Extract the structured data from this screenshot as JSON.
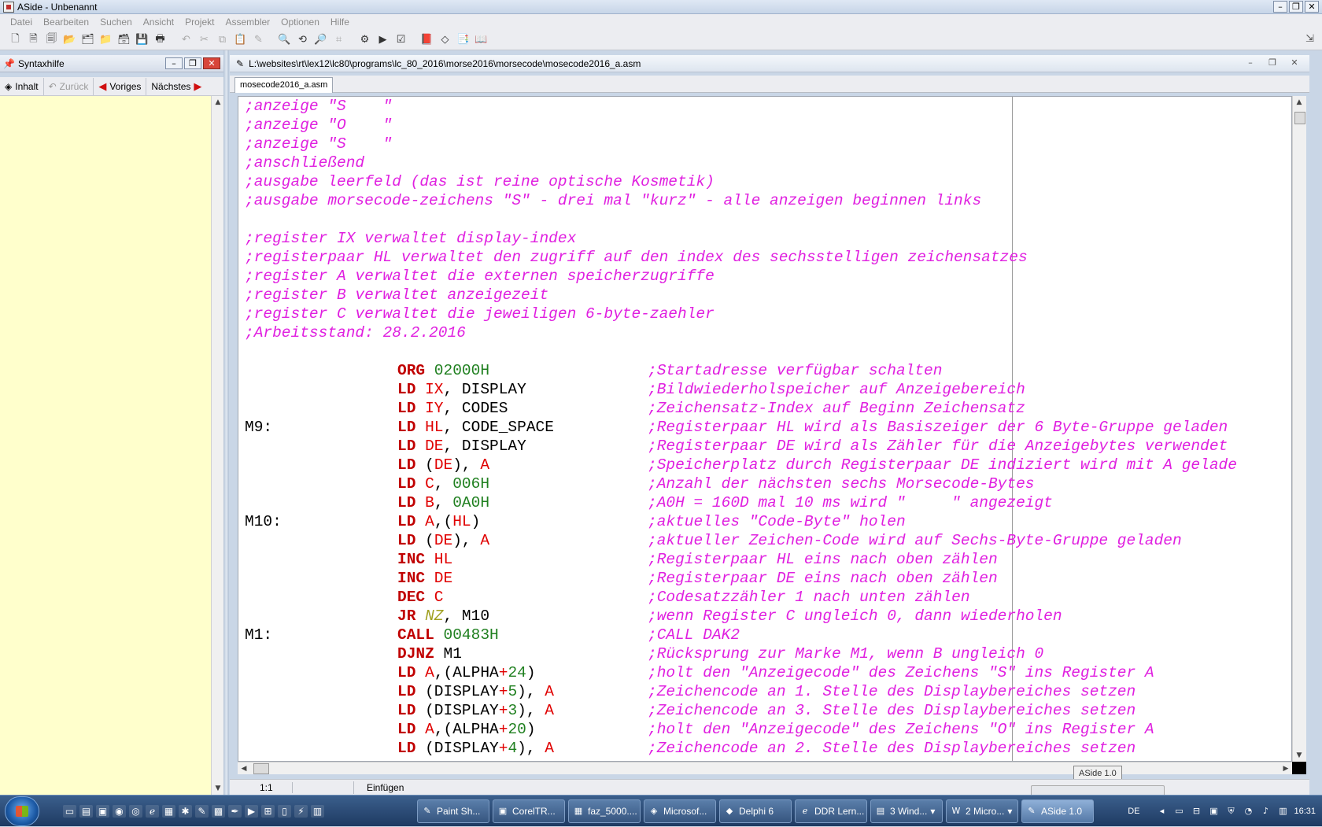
{
  "window": {
    "title": "ASide - Unbenannt"
  },
  "menu": [
    "Datei",
    "Bearbeiten",
    "Suchen",
    "Ansicht",
    "Projekt",
    "Assembler",
    "Optionen",
    "Hilfe"
  ],
  "left_panel": {
    "title": "Syntaxhilfe",
    "nav": {
      "contents": "Inhalt",
      "back": "Zurück",
      "previous": "Voriges",
      "next": "Nächstes"
    }
  },
  "editor": {
    "path": "L:\\websites\\rt\\lex12\\lc80\\programs\\lc_80_2016\\morse2016\\morsecode\\mosecode2016_a.asm",
    "tab": "mosecode2016_a.asm",
    "header_comments": [
      ";anzeige \"S    \"",
      ";anzeige \"O    \"",
      ";anzeige \"S    \"",
      ";anschließend",
      ";ausgabe leerfeld (das ist reine optische Kosmetik)",
      ";ausgabe morsecode-zeichens \"S\" - drei mal \"kurz\" - alle anzeigen beginnen links",
      "",
      ";register IX verwaltet display-index",
      ";registerpaar HL verwaltet den zugriff auf den index des sechsstelligen zeichensatzes",
      ";register A verwaltet die externen speicherzugriffe",
      ";register B verwaltet anzeigezeit",
      ";register C verwaltet die jeweiligen 6-byte-zaehler",
      ";Arbeitsstand: 28.2.2016",
      ""
    ],
    "code_lines": [
      {
        "label": "",
        "op": "ORG",
        "args": [
          [
            "nm",
            " 02000H"
          ]
        ],
        "comment": ";Startadresse verfügbar schalten"
      },
      {
        "label": "",
        "op": "LD",
        "args": [
          [
            "rg",
            " IX"
          ],
          [
            "pl",
            ", DISPLAY"
          ]
        ],
        "comment": ";Bildwiederholspeicher auf Anzeigebereich"
      },
      {
        "label": "",
        "op": "LD",
        "args": [
          [
            "rg",
            " IY"
          ],
          [
            "pl",
            ", CODES"
          ]
        ],
        "comment": ";Zeichensatz-Index auf Beginn Zeichensatz"
      },
      {
        "label": "M9:",
        "op": "LD",
        "args": [
          [
            "rg",
            " HL"
          ],
          [
            "pl",
            ", CODE_SPACE"
          ]
        ],
        "comment": ";Registerpaar HL wird als Basiszeiger der 6 Byte-Gruppe geladen"
      },
      {
        "label": "",
        "op": "LD",
        "args": [
          [
            "rg",
            " DE"
          ],
          [
            "pl",
            ", DISPLAY"
          ]
        ],
        "comment": ";Registerpaar DE wird als Zähler für die Anzeigebytes verwendet"
      },
      {
        "label": "",
        "op": "LD",
        "args": [
          [
            "pl",
            " ("
          ],
          [
            "rg",
            "DE"
          ],
          [
            "pl",
            "), "
          ],
          [
            "rg",
            "A"
          ]
        ],
        "comment": ";Speicherplatz durch Registerpaar DE indiziert wird mit A gelade"
      },
      {
        "label": "",
        "op": "LD",
        "args": [
          [
            "rg",
            " C"
          ],
          [
            "pl",
            ", "
          ],
          [
            "nm",
            "006H"
          ]
        ],
        "comment": ";Anzahl der nächsten sechs Morsecode-Bytes"
      },
      {
        "label": "",
        "op": "LD",
        "args": [
          [
            "rg",
            " B"
          ],
          [
            "pl",
            ", "
          ],
          [
            "nm",
            "0A0H"
          ]
        ],
        "comment": ";A0H = 160D mal 10 ms wird \"     \" angezeigt"
      },
      {
        "label": "M10:",
        "op": "LD",
        "args": [
          [
            "rg",
            " A"
          ],
          [
            "pl",
            ",("
          ],
          [
            "rg",
            "HL"
          ],
          [
            "pl",
            ")"
          ]
        ],
        "comment": ";aktuelles \"Code-Byte\" holen"
      },
      {
        "label": "",
        "op": "LD",
        "args": [
          [
            "pl",
            " ("
          ],
          [
            "rg",
            "DE"
          ],
          [
            "pl",
            "), "
          ],
          [
            "rg",
            "A"
          ]
        ],
        "comment": ";aktueller Zeichen-Code wird auf Sechs-Byte-Gruppe geladen"
      },
      {
        "label": "",
        "op": "INC",
        "args": [
          [
            "rg",
            " HL"
          ]
        ],
        "comment": ";Registerpaar HL eins nach oben zählen"
      },
      {
        "label": "",
        "op": "INC",
        "args": [
          [
            "rg",
            " DE"
          ]
        ],
        "comment": ";Registerpaar DE eins nach oben zählen"
      },
      {
        "label": "",
        "op": "DEC",
        "args": [
          [
            "rg",
            " C"
          ]
        ],
        "comment": ";Codesatzzähler 1 nach unten zählen"
      },
      {
        "label": "",
        "op": "JR",
        "args": [
          [
            "cc",
            " NZ"
          ],
          [
            "pl",
            ", M10"
          ]
        ],
        "comment": ";wenn Register C ungleich 0, dann wiederholen"
      },
      {
        "label": "M1:",
        "op": "CALL",
        "args": [
          [
            "nm",
            " 00483H"
          ]
        ],
        "comment": ";CALL DAK2"
      },
      {
        "label": "",
        "op": "DJNZ",
        "args": [
          [
            "pl",
            " M1"
          ]
        ],
        "comment": ";Rücksprung zur Marke M1, wenn B ungleich 0"
      },
      {
        "label": "",
        "op": "LD",
        "args": [
          [
            "rg",
            " A"
          ],
          [
            "pl",
            ",(ALPHA"
          ],
          [
            "rg",
            "+"
          ],
          [
            "nm",
            "24"
          ],
          [
            "pl",
            ")"
          ]
        ],
        "comment": ";holt den \"Anzeigecode\" des Zeichens \"S\" ins Register A"
      },
      {
        "label": "",
        "op": "LD",
        "args": [
          [
            "pl",
            " (DISPLAY"
          ],
          [
            "rg",
            "+"
          ],
          [
            "nm",
            "5"
          ],
          [
            "pl",
            "), "
          ],
          [
            "rg",
            "A"
          ]
        ],
        "comment": ";Zeichencode an 1. Stelle des Displaybereiches setzen"
      },
      {
        "label": "",
        "op": "LD",
        "args": [
          [
            "pl",
            " (DISPLAY"
          ],
          [
            "rg",
            "+"
          ],
          [
            "nm",
            "3"
          ],
          [
            "pl",
            "), "
          ],
          [
            "rg",
            "A"
          ]
        ],
        "comment": ";Zeichencode an 3. Stelle des Displaybereiches setzen"
      },
      {
        "label": "",
        "op": "LD",
        "args": [
          [
            "rg",
            " A"
          ],
          [
            "pl",
            ",(ALPHA"
          ],
          [
            "rg",
            "+"
          ],
          [
            "nm",
            "20"
          ],
          [
            "pl",
            ")"
          ]
        ],
        "comment": ";holt den \"Anzeigecode\" des Zeichens \"O\" ins Register A"
      },
      {
        "label": "",
        "op": "LD",
        "args": [
          [
            "pl",
            " (DISPLAY"
          ],
          [
            "rg",
            "+"
          ],
          [
            "nm",
            "4"
          ],
          [
            "pl",
            "), "
          ],
          [
            "rg",
            "A"
          ]
        ],
        "comment": ";Zeichencode an 2. Stelle des Displaybereiches setzen"
      }
    ]
  },
  "status": {
    "position": "1:1",
    "mode": "Einfügen",
    "tooltip": "ASide 1.0"
  },
  "taskbar": {
    "tasks": [
      "Paint Sh...",
      "CorelTR...",
      "faz_5000....",
      "Microsof...",
      "Delphi 6",
      "DDR Lern...",
      "3 Wind...",
      "2 Micro...",
      "ASide 1.0"
    ],
    "language": "DE",
    "clock": "16:31"
  },
  "colors": {
    "comment": "#e020e0",
    "keyword": "#c00000",
    "register": "#e00000",
    "number": "#208020",
    "condition": "#a0a020",
    "help_background": "#ffffcc"
  }
}
